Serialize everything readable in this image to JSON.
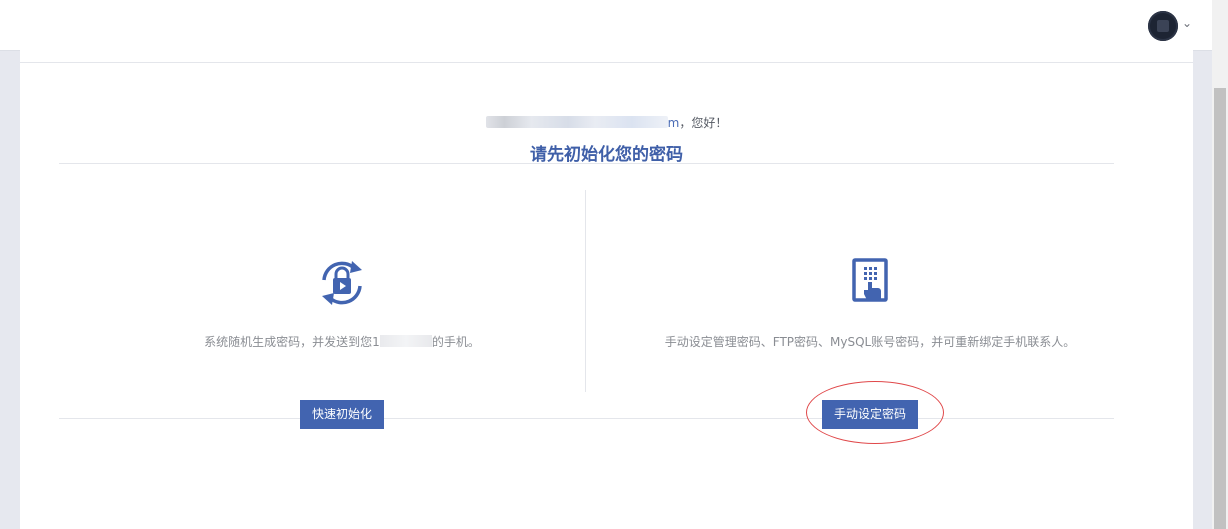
{
  "header": {
    "avatar_icon": "user-avatar-icon",
    "menu_caret": "⌄"
  },
  "greeting": {
    "email_suffix": "m",
    "text": "，您好！"
  },
  "title": "请先初始化您的密码",
  "options": {
    "quick": {
      "icon": "refresh-lock-icon",
      "desc_prefix": "系统随机生成密码，并发送到您1",
      "desc_suffix": "的手机。",
      "button_label": "快速初始化"
    },
    "manual": {
      "icon": "keypad-phone-icon",
      "desc": "手动设定管理密码、FTP密码、MySQL账号密码，并可重新绑定手机联系人。",
      "button_label": "手动设定密码"
    }
  },
  "colors": {
    "accent": "#4264b0",
    "title": "#3f5fa8",
    "annotation": "#e0484a"
  }
}
